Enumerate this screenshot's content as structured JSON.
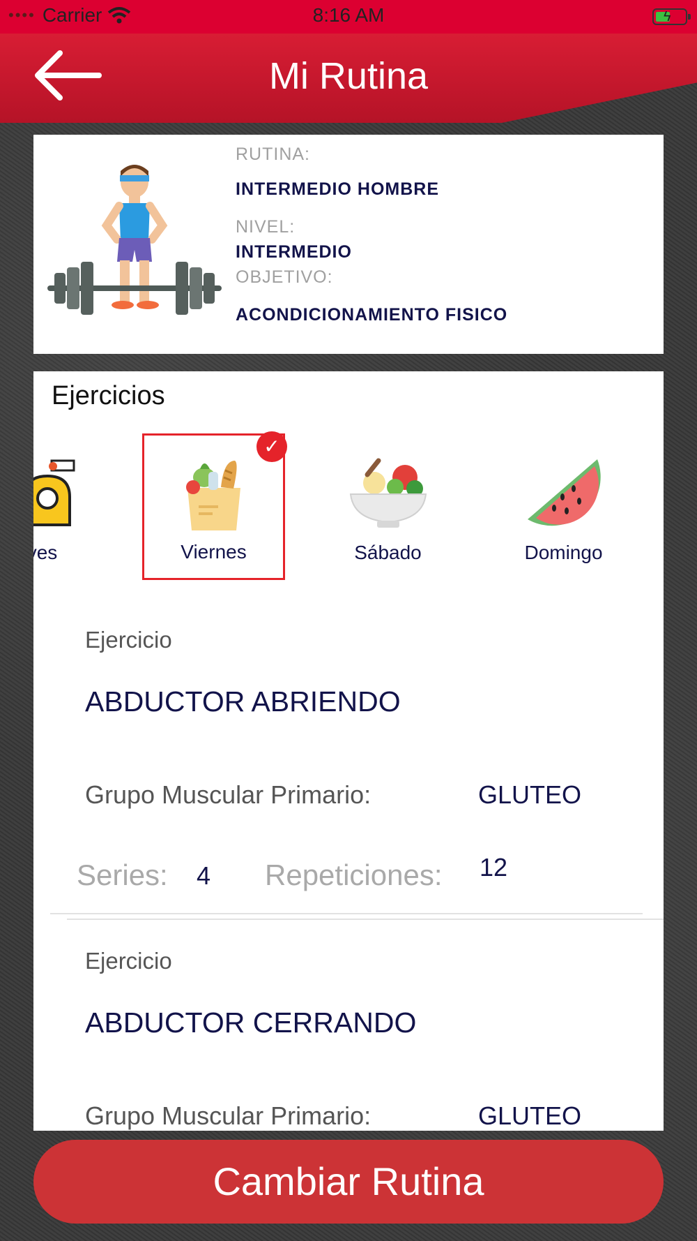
{
  "status_bar": {
    "carrier": "Carrier",
    "time": "8:16 AM"
  },
  "header": {
    "title": "Mi Rutina"
  },
  "routine": {
    "rutina_label": "RUTINA:",
    "rutina_value": "INTERMEDIO HOMBRE",
    "nivel_label": "NIVEL:",
    "nivel_value": "INTERMEDIO",
    "objetivo_label": "OBJETIVO:",
    "objetivo_value": "ACONDICIONAMIENTO FISICO"
  },
  "exercises_section": {
    "title": "Ejercicios",
    "days": [
      {
        "label": "ves",
        "icon": "measuring-tape-icon"
      },
      {
        "label": "Viernes",
        "icon": "grocery-bag-icon",
        "selected": true
      },
      {
        "label": "Sábado",
        "icon": "salad-bowl-icon"
      },
      {
        "label": "Domingo",
        "icon": "watermelon-icon"
      }
    ],
    "items": [
      {
        "small_label": "Ejercicio",
        "name": "ABDUCTOR ABRIENDO",
        "muscle_label": "Grupo Muscular Primario:",
        "muscle_value": "GLUTEO",
        "series_label": "Series:",
        "series_value": "4",
        "reps_label": "Repeticiones:",
        "reps_value": "12"
      },
      {
        "small_label": "Ejercicio",
        "name": "ABDUCTOR CERRANDO",
        "muscle_label": "Grupo Muscular Primario:",
        "muscle_value": "GLUTEO"
      }
    ]
  },
  "actions": {
    "change_routine": "Cambiar Rutina"
  },
  "colors": {
    "primary_red": "#dc0031",
    "button_red": "#cc3336",
    "navy": "#12134a"
  }
}
